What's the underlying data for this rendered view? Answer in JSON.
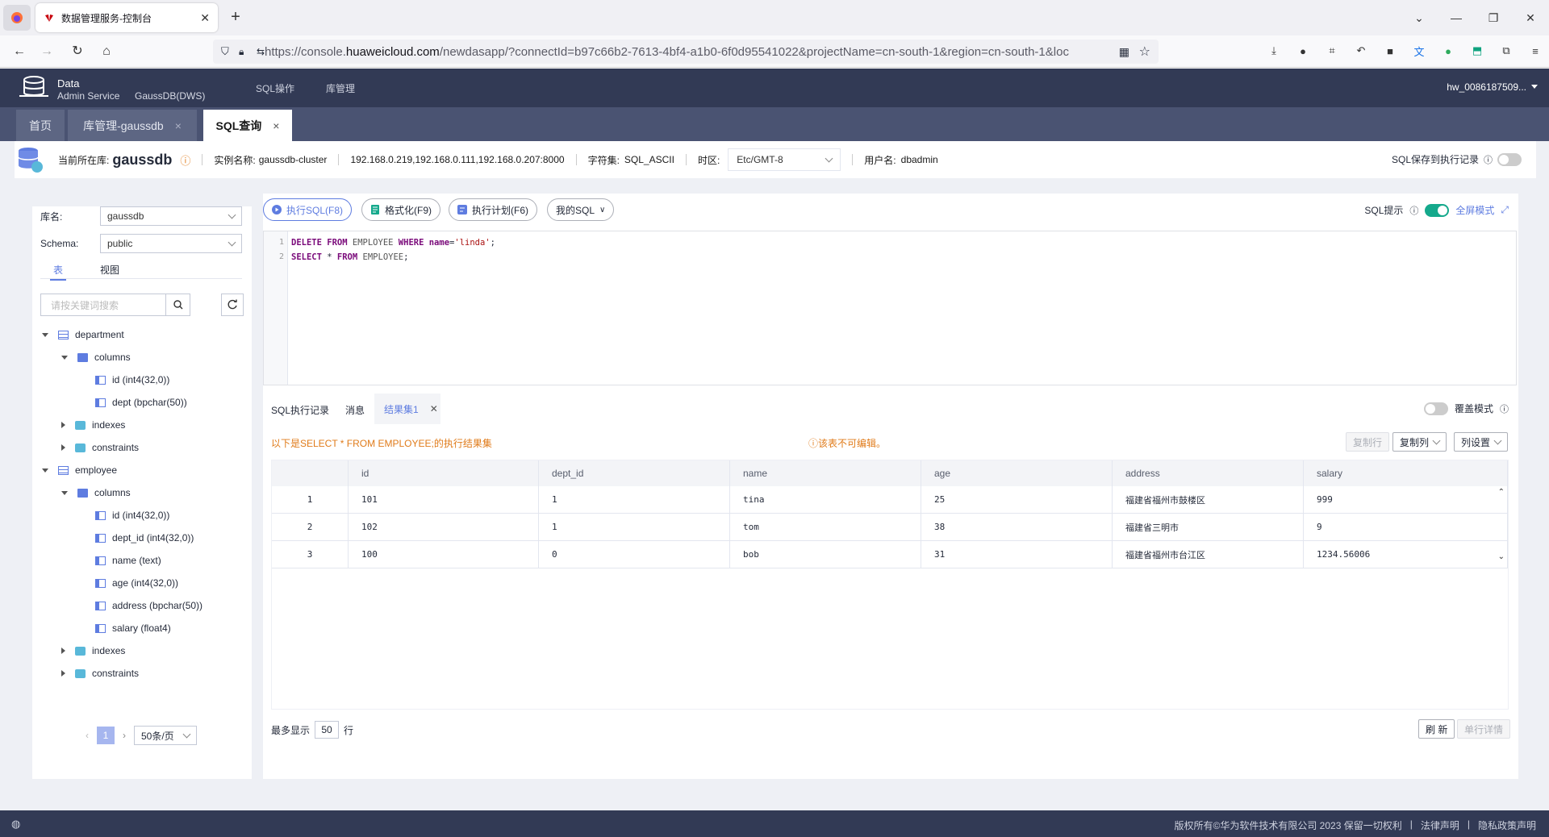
{
  "browser": {
    "tab_title": "数据管理服务-控制台",
    "url_prefix": "https://console.",
    "url_host": "huaweicloud.com",
    "url_rest": "/newdasapp/?connectId=b97c66b2-7613-4bf4-a1b0-6f0d95541022&projectName=cn-south-1&region=cn-south-1&loc"
  },
  "header": {
    "brand_line1": "Data",
    "brand_line2": "Admin Service",
    "brand_product": "GaussDB(DWS)",
    "nav": [
      "SQL操作",
      "库管理"
    ],
    "user": "hw_0086187509..."
  },
  "page_tabs": [
    {
      "label": "首页"
    },
    {
      "label": "库管理-gaussdb"
    },
    {
      "label": "SQL查询"
    }
  ],
  "context": {
    "current_db_label": "当前所在库:",
    "current_db": "gaussdb",
    "instance_label": "实例名称:",
    "instance": "gaussdb-cluster",
    "hosts": "192.168.0.219,192.168.0.111,192.168.0.207:8000",
    "charset_label": "字符集:",
    "charset": "SQL_ASCII",
    "tz_label": "时区:",
    "tz": "Etc/GMT-8",
    "user_label": "用户名:",
    "user": "dbadmin",
    "save_label": "SQL保存到执行记录"
  },
  "left": {
    "db_label": "库名:",
    "db_value": "gaussdb",
    "schema_label": "Schema:",
    "schema_value": "public",
    "tab_table": "表",
    "tab_view": "视图",
    "search_placeholder": "请按关键词搜索",
    "tree": {
      "department": "department",
      "columns": "columns",
      "indexes": "indexes",
      "constraints": "constraints",
      "employee": "employee",
      "dept_cols": [
        "id (int4(32,0))",
        "dept (bpchar(50))"
      ],
      "emp_cols": [
        "id (int4(32,0))",
        "dept_id (int4(32,0))",
        "name (text)",
        "age (int4(32,0))",
        "address (bpchar(50))",
        "salary (float4)"
      ]
    },
    "page_current": "1",
    "page_size": "50条/页"
  },
  "toolbar": {
    "run": "执行SQL(F8)",
    "format": "格式化(F9)",
    "plan": "执行计划(F6)",
    "my_sql": "我的SQL",
    "sql_hint": "SQL提示",
    "fullscreen": "全屏模式"
  },
  "editor": {
    "line_numbers": [
      "1",
      "2"
    ]
  },
  "results": {
    "tabs": [
      "SQL执行记录",
      "消息",
      "结果集1"
    ],
    "overwrite": "覆盖模式",
    "msg": "以下是SELECT * FROM EMPLOYEE;的执行结果集",
    "warn": "该表不可编辑。",
    "copy_row": "复制行",
    "copy_col": "复制列",
    "col_settings": "列设置",
    "columns": [
      "",
      "id",
      "dept_id",
      "name",
      "age",
      "address",
      "salary"
    ],
    "rows": [
      [
        "1",
        "101",
        "1",
        "tina",
        "25",
        "福建省福州市鼓楼区",
        "999"
      ],
      [
        "2",
        "102",
        "1",
        "tom",
        "38",
        "福建省三明市",
        "9"
      ],
      [
        "3",
        "100",
        "0",
        "bob",
        "31",
        "福建省福州市台江区",
        "1234.56006"
      ]
    ],
    "max_show": "最多显示",
    "max_value": "50",
    "max_unit": "行",
    "refresh": "刷 新",
    "row_detail": "单行详情"
  },
  "footer": {
    "copyright": "版权所有©华为软件技术有限公司 2023 保留一切权利",
    "legal": "法律声明",
    "privacy": "隐私政策声明"
  }
}
